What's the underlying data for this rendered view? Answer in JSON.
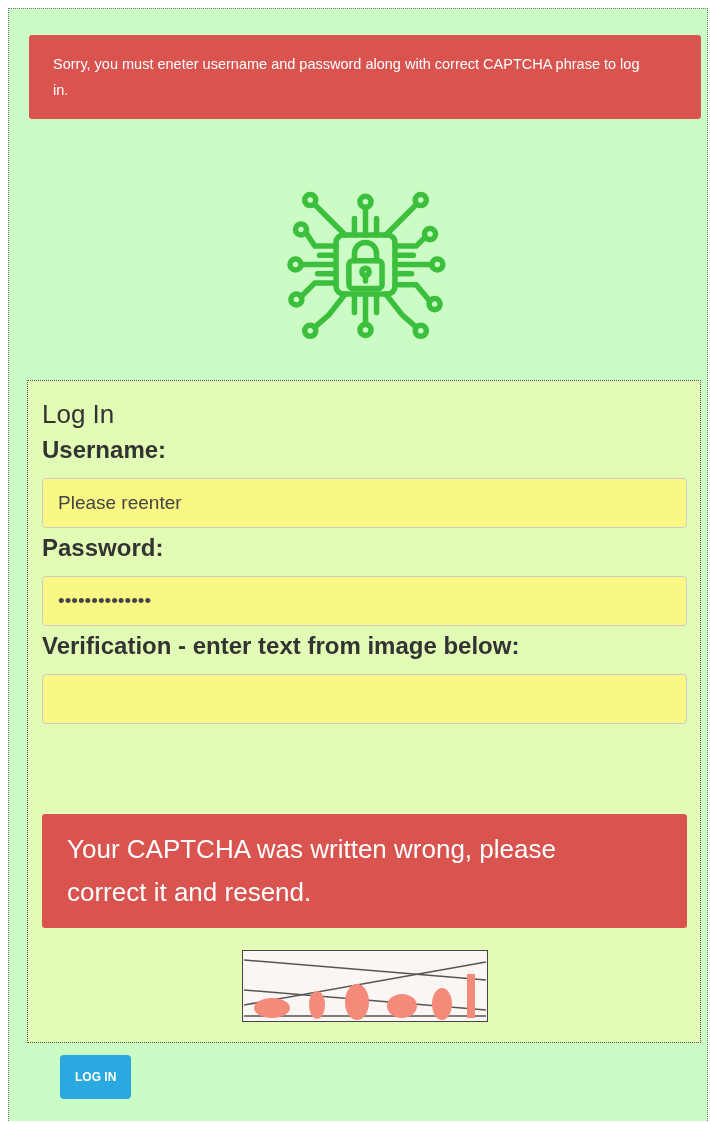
{
  "top_alert": {
    "text": "Sorry, you must eneter username and password along with correct CAPTCHA phrase to log in."
  },
  "login": {
    "title": "Log In",
    "fields": [
      {
        "label": "Username:",
        "value": "Please reenter"
      },
      {
        "label": "Password:",
        "value": "••••••••••••••"
      },
      {
        "label": "Verification - enter text from image below:"
      }
    ],
    "error": "Your CAPTCHA was written wrong, please correct it and resend."
  },
  "button": "LOG IN"
}
